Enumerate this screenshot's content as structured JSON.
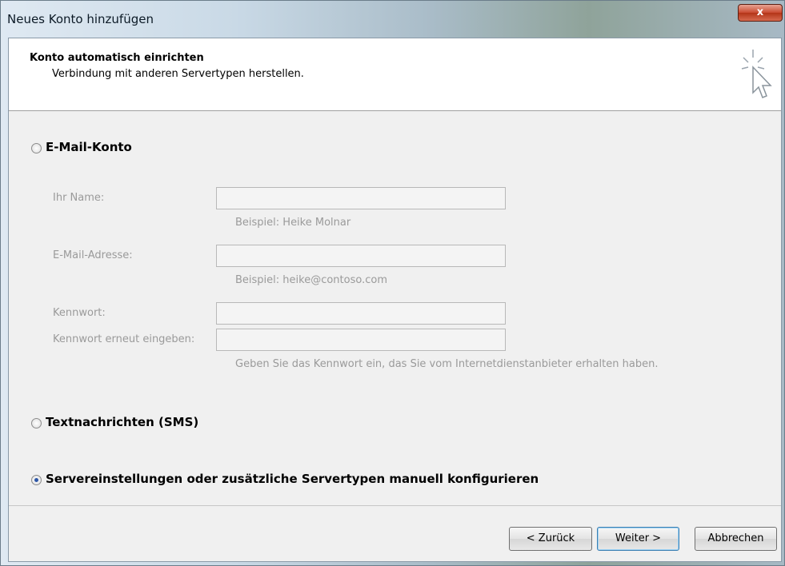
{
  "window": {
    "title": "Neues Konto hinzufügen",
    "close_glyph": "x"
  },
  "header": {
    "title": "Konto automatisch einrichten",
    "subtitle": "Verbindung mit anderen Servertypen herstellen.",
    "icon": "wizard-cursor-icon"
  },
  "email_section": {
    "label": "E-Mail-Konto",
    "selected": false,
    "name_label": "Ihr Name:",
    "name_value": "",
    "name_hint": "Beispiel: Heike Molnar",
    "email_label": "E-Mail-Adresse:",
    "email_value": "",
    "email_hint": "Beispiel: heike@contoso.com",
    "password_label": "Kennwort:",
    "password_value": "",
    "password_repeat_label": "Kennwort erneut eingeben:",
    "password_repeat_value": "",
    "password_hint": "Geben Sie das Kennwort ein, das Sie vom Internetdienstanbieter erhalten haben."
  },
  "sms_section": {
    "label": "Textnachrichten (SMS)",
    "selected": false
  },
  "manual_section": {
    "label": "Servereinstellungen oder zusätzliche Servertypen manuell konfigurieren",
    "selected": true
  },
  "buttons": {
    "back": "< Zurück",
    "next": "Weiter >",
    "cancel": "Abbrechen"
  },
  "colors": {
    "radio_dot": "#2d56a6",
    "disabled_text": "#9a9a9a",
    "close_red": "#c94a2f"
  }
}
